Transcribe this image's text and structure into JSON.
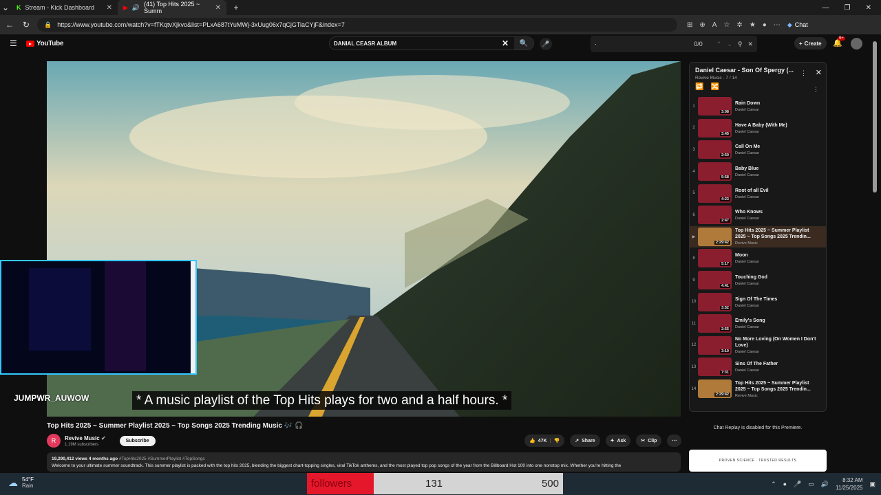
{
  "browser": {
    "tabs": [
      {
        "title": "Stream - Kick Dashboard",
        "icon": "kick-icon",
        "close": "✕"
      },
      {
        "title": "(41) Top Hits 2025 ~ Summ",
        "icon": "youtube-icon",
        "close": "✕"
      }
    ],
    "new_tab": "+",
    "url": "https://www.youtube.com/watch?v=fTKqtvXjkvo&list=PLxA687tYuMWj-3xUug06x7qCjGTiaCYjF&index=7",
    "chat_label": "Chat"
  },
  "yt": {
    "logo": "YouTube",
    "search_value": "DANIAL CEASR ALBUM",
    "find_count": "0/0",
    "find_value": "·",
    "create_label": "Create",
    "notif_badge": "9+"
  },
  "video": {
    "caption": "* A music playlist of the Top Hits plays for two and a half hours. *",
    "streamer_name": "JUMPWR_AUWOW",
    "title": "Top Hits 2025 ~ Summer Playlist 2025 ~ Top Songs 2025 Trending Music 🎶 🎧",
    "channel": "Revive Music",
    "channel_initial": "R",
    "subs": "1.19M subscribers",
    "subscribe": "Subscribe",
    "likes": "47K",
    "share": "Share",
    "ask": "Ask",
    "clip": "Clip",
    "views": "19,290,412 views  4 months ago",
    "tags": "#TopHits2025 #SummerPlaylist #TopSongs",
    "desc": "Welcome to your ultimate summer soundtrack. This summer playlist is packed with the top hits 2025, blending the biggest chart-topping singles, viral TikTok anthems, and the most played top pop songs of the year from the Billboard Hot 100 into one nonstop mix. Whether you're hitting the"
  },
  "playlist": {
    "title": "Daniel Caesar - Son Of Spergy (...",
    "sub": "Revive Music - 7 / 14",
    "items": [
      {
        "idx": "1",
        "name": "Rain Down",
        "artist": "Daniel Caesar",
        "dur": "3:08"
      },
      {
        "idx": "2",
        "name": "Have A Baby (With Me)",
        "artist": "Daniel Caesar",
        "dur": "3:45"
      },
      {
        "idx": "3",
        "name": "Call On Me",
        "artist": "Daniel Caesar",
        "dur": "2:50"
      },
      {
        "idx": "4",
        "name": "Baby Blue",
        "artist": "Daniel Caesar",
        "dur": "5:58"
      },
      {
        "idx": "5",
        "name": "Root of all Evil",
        "artist": "Daniel Caesar",
        "dur": "4:23"
      },
      {
        "idx": "6",
        "name": "Who Knows",
        "artist": "Daniel Caesar",
        "dur": "2:47"
      },
      {
        "idx": "▶",
        "name": "Top Hits 2025 ~ Summer Playlist 2025 ~ Top Songs 2025 Trendin...",
        "artist": "Revive Music",
        "dur": "2:29:42"
      },
      {
        "idx": "8",
        "name": "Moon",
        "artist": "Daniel Caesar",
        "dur": "5:17"
      },
      {
        "idx": "9",
        "name": "Touching God",
        "artist": "Daniel Caesar",
        "dur": "4:41"
      },
      {
        "idx": "10",
        "name": "Sign Of The Times",
        "artist": "Daniel Caesar",
        "dur": "3:52"
      },
      {
        "idx": "11",
        "name": "Emily's Song",
        "artist": "Daniel Caesar",
        "dur": "2:55"
      },
      {
        "idx": "12",
        "name": "No More Loving (On Women I Don't Love)",
        "artist": "Daniel Caesar",
        "dur": "3:10"
      },
      {
        "idx": "13",
        "name": "Sins Of The Father",
        "artist": "Daniel Caesar",
        "dur": "7:31"
      },
      {
        "idx": "14",
        "name": "Top Hits 2025 ~ Summer Playlist 2025 ~ Top Songs 2025 Trendin...",
        "artist": "Revive Music",
        "dur": "2:29:42"
      }
    ],
    "chat_disabled": "Chat Replay is disabled for this Premiere.",
    "ad_text": "PROVEN SCIENCE · TRUSTED RESULTS"
  },
  "overlay": {
    "followers_label": "followers",
    "followers_current": "131",
    "followers_goal": "500",
    "followers_progress": 0.262
  },
  "taskbar": {
    "temp": "54°F",
    "weather": "Rain",
    "time": "8:32 AM",
    "date": "11/25/2025"
  },
  "colors": {
    "accent": "#ff0000",
    "follow_fill": "#e5182b",
    "webcam_border": "#34c8ff"
  }
}
